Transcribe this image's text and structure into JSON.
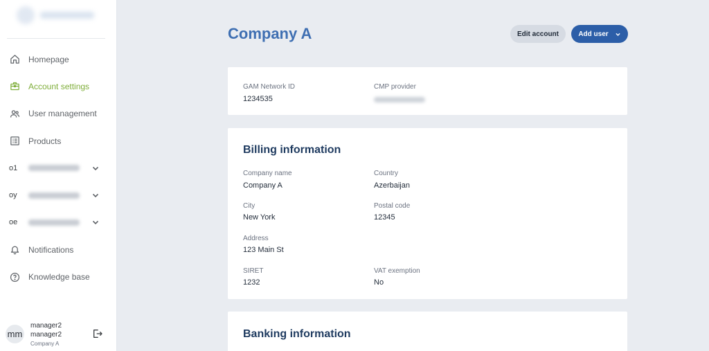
{
  "sidebar": {
    "items": [
      {
        "label": "Homepage",
        "icon": "home-icon"
      },
      {
        "label": "Account settings",
        "icon": "briefcase-icon",
        "active": true
      },
      {
        "label": "User management",
        "icon": "users-icon"
      },
      {
        "label": "Products",
        "icon": "list-icon"
      },
      {
        "abbr": "o1",
        "label": "",
        "expandable": true
      },
      {
        "abbr": "oy",
        "label": "",
        "expandable": true
      },
      {
        "abbr": "oe",
        "label": "",
        "expandable": true
      },
      {
        "label": "Notifications",
        "icon": "bell-icon"
      },
      {
        "label": "Knowledge base",
        "icon": "help-circle-icon"
      }
    ],
    "user": {
      "initials": "mm",
      "name_line1": "manager2",
      "name_line2": "manager2",
      "company": "Company A"
    }
  },
  "header": {
    "title": "Company A",
    "edit_label": "Edit account",
    "add_user_label": "Add user"
  },
  "network": {
    "gam_label": "GAM Network ID",
    "gam_value": "1234535",
    "cmp_label": "CMP provider"
  },
  "billing": {
    "title": "Billing information",
    "company_name_label": "Company name",
    "company_name": "Company A",
    "country_label": "Country",
    "country": "Azerbaijan",
    "city_label": "City",
    "city": "New York",
    "postal_label": "Postal code",
    "postal": "12345",
    "address_label": "Address",
    "address": "123 Main St",
    "siret_label": "SIRET",
    "siret": "1232",
    "vat_label": "VAT exemption",
    "vat": "No"
  },
  "banking": {
    "title": "Banking information"
  },
  "colors": {
    "accent_active": "#7fae3a",
    "title_blue": "#3f6fb2",
    "primary_button": "#2c5ea8",
    "background": "#e9ecf1"
  }
}
